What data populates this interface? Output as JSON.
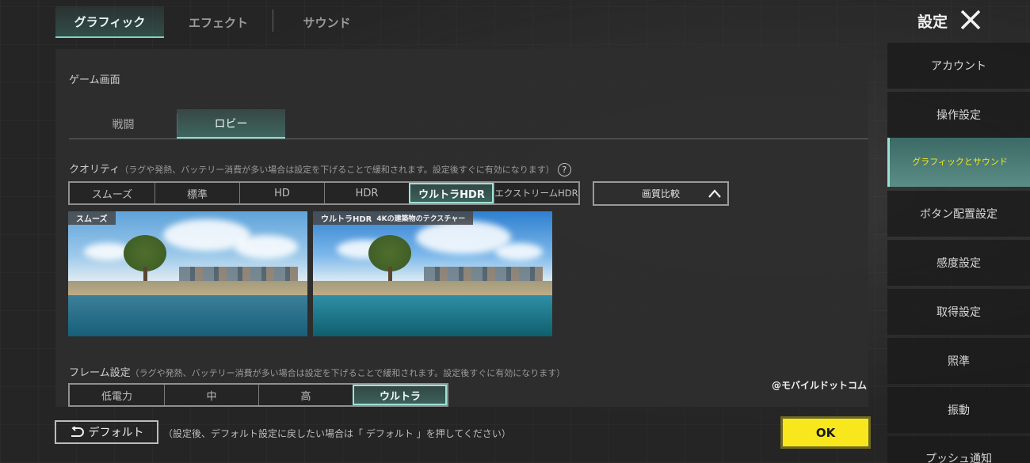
{
  "header": {
    "tabs": [
      {
        "label": "グラフィック",
        "active": true
      },
      {
        "label": "エフェクト",
        "active": false
      },
      {
        "label": "サウンド",
        "active": false
      }
    ],
    "title": "設定"
  },
  "panel": {
    "section_title": "ゲーム画面",
    "sub_tabs": [
      {
        "label": "戦闘",
        "active": false
      },
      {
        "label": "ロビー",
        "active": true
      }
    ],
    "quality": {
      "label": "クオリティ",
      "note": "（ラグや発熱、バッテリー消費が多い場合は設定を下げることで緩和されます。設定後すぐに有効になります）",
      "help_glyph": "?",
      "options": [
        "スムーズ",
        "標準",
        "HD",
        "HDR",
        "ウルトラHDR",
        "エクストリームHDR"
      ],
      "selected": "ウルトラHDR",
      "compare_label": "画質比較",
      "compare_expanded": true
    },
    "previews": [
      {
        "tag": "スムーズ",
        "sub": ""
      },
      {
        "tag": "ウルトラHDR",
        "sub": "4Kの建築物のテクスチャー"
      }
    ],
    "frame": {
      "label": "フレーム設定",
      "note": "（ラグや発熱、バッテリー消費が多い場合は設定を下げることで緩和されます。設定後すぐに有効になります）",
      "options": [
        "低電力",
        "中",
        "高",
        "ウルトラ"
      ],
      "selected": "ウルトラ"
    },
    "watermark": "@モバイルドットコム"
  },
  "footer": {
    "default_label": "デフォルト",
    "default_note": "（設定後、デフォルト設定に戻したい場合は「 デフォルト 」を押してください）",
    "ok_label": "OK"
  },
  "sidebar": {
    "items": [
      {
        "label": "アカウント",
        "active": false
      },
      {
        "label": "操作設定",
        "active": false
      },
      {
        "label": "グラフィックとサウンド",
        "active": true
      },
      {
        "label": "ボタン配置設定",
        "active": false
      },
      {
        "label": "感度設定",
        "active": false
      },
      {
        "label": "取得設定",
        "active": false
      },
      {
        "label": "照準",
        "active": false
      },
      {
        "label": "振動",
        "active": false
      },
      {
        "label": "プッシュ通知",
        "active": false
      }
    ]
  },
  "colors": {
    "accent": "#8adccd",
    "ok_button": "#f8e71c",
    "active_sidebar_text": "#f8e71c"
  }
}
